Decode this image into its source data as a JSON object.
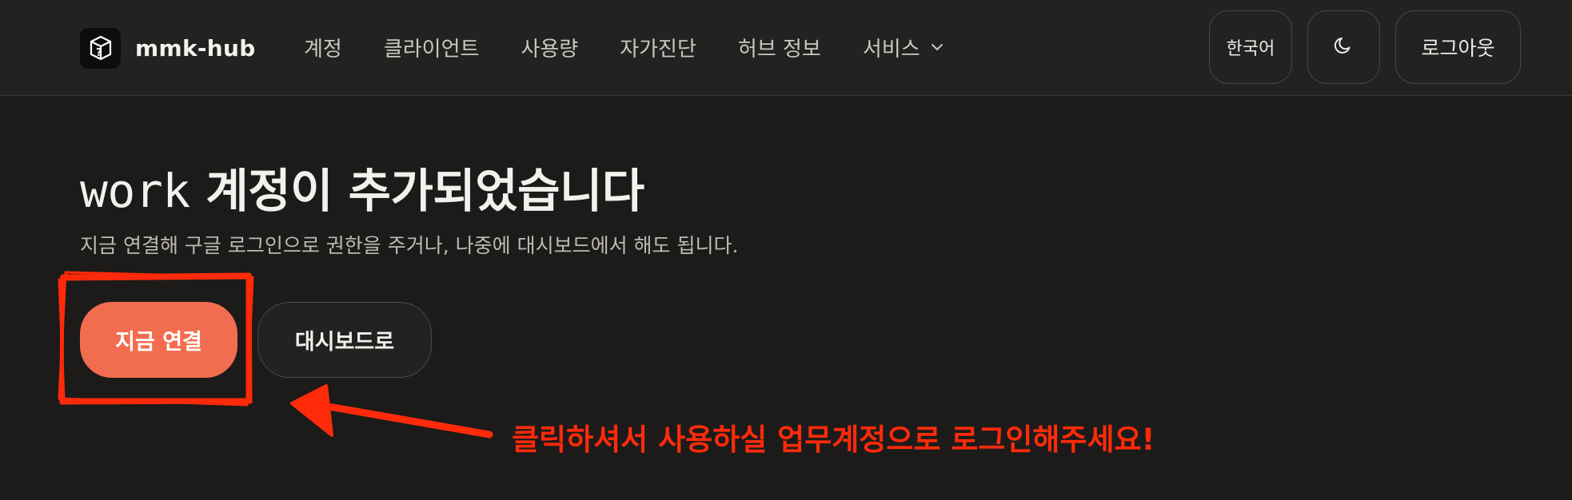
{
  "app": {
    "logo_text": "mmk-hub",
    "logo_icon": "cube-question-icon"
  },
  "nav": {
    "items": [
      {
        "label": "계정"
      },
      {
        "label": "클라이언트"
      },
      {
        "label": "사용량"
      },
      {
        "label": "자가진단"
      },
      {
        "label": "허브 정보"
      },
      {
        "label": "서비스",
        "has_dropdown": true
      }
    ]
  },
  "header_actions": {
    "language": "한국어",
    "theme_icon": "moon-icon",
    "logout": "로그아웃"
  },
  "main": {
    "title_account": "work",
    "title_rest": " 계정이 추가되었습니다",
    "subtitle": "지금 연결해 구글 로그인으로 권한을 주거나, 나중에 대시보드에서 해도 됩니다.",
    "primary_button": "지금 연결",
    "secondary_button": "대시보드로"
  },
  "annotation": {
    "text": "클릭하셔서 사용하실 업무계정으로 로그인해주세요!",
    "color": "#ff2a0a"
  },
  "colors": {
    "accent": "#f26d4f",
    "background": "#1c1b1a",
    "header": "#232220"
  }
}
